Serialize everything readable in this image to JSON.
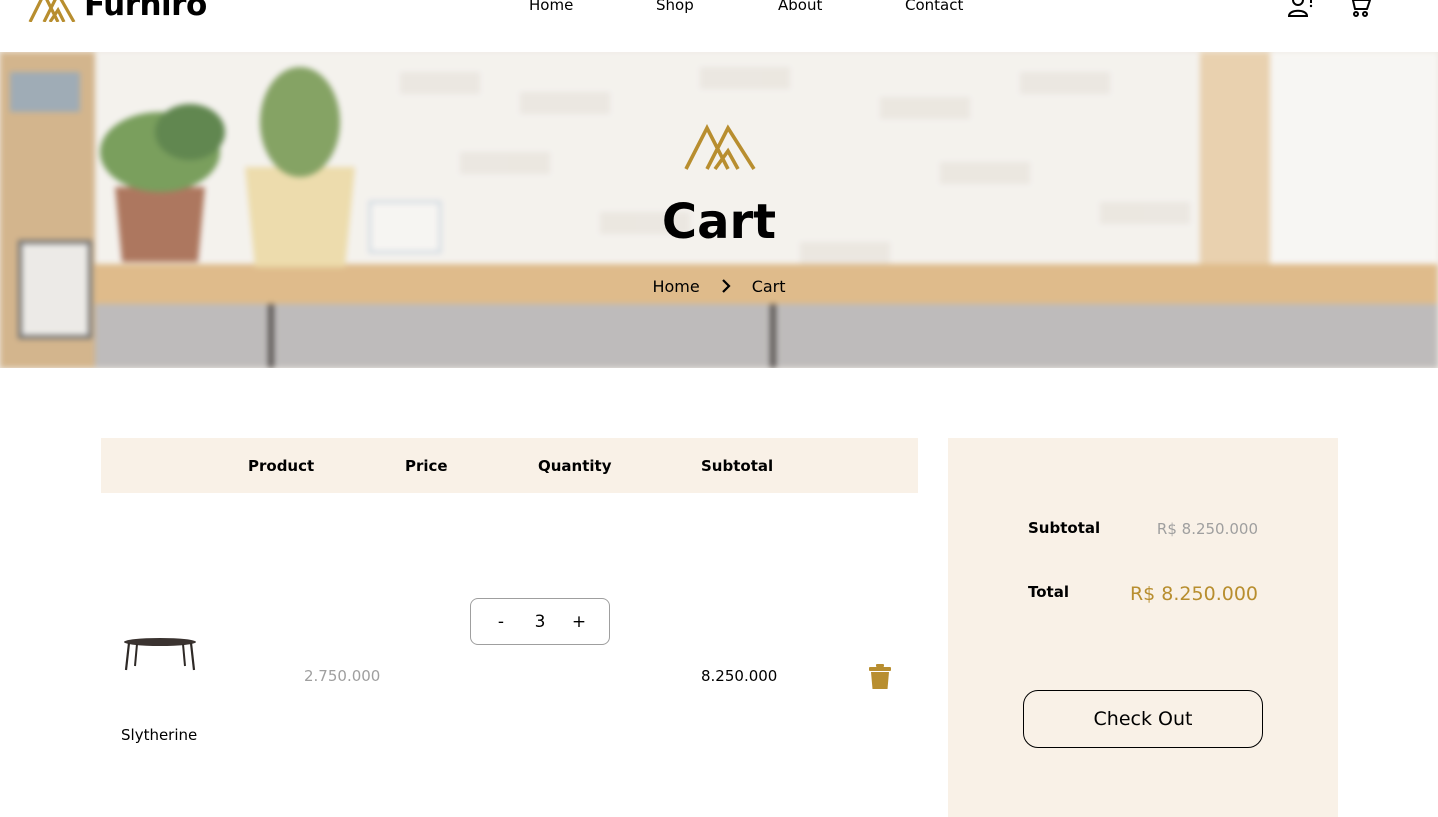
{
  "colors": {
    "accent": "#b88e2f",
    "beige": "#f9f1e7",
    "muted_text": "#9f9f9f",
    "text": "#000000"
  },
  "header": {
    "brand": "Furniro",
    "nav": [
      "Home",
      "Shop",
      "About",
      "Contact"
    ],
    "icons": [
      "user-alert-icon",
      "cart-icon"
    ]
  },
  "hero": {
    "title": "Cart",
    "breadcrumb": [
      "Home",
      "Cart"
    ]
  },
  "cart": {
    "columns": [
      "Product",
      "Price",
      "Quantity",
      "Subtotal"
    ],
    "items": [
      {
        "name": "Slytherine",
        "price": "2.750.000",
        "quantity": "3",
        "subtotal": "8.250.000",
        "icon": "dining-table-icon"
      }
    ],
    "qty_decrement": "-",
    "qty_increment": "+"
  },
  "totals": {
    "subtotal_label": "Subtotal",
    "subtotal_value": "R$ 8.250.000",
    "total_label": "Total",
    "total_value": "R$ 8.250.000",
    "checkout_label": "Check Out"
  }
}
